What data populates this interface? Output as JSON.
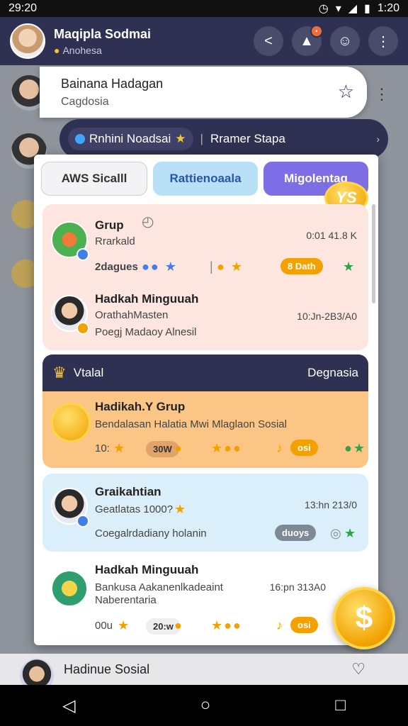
{
  "status": {
    "time": "29:20",
    "right_time": "1:20"
  },
  "appbar": {
    "title": "Maqipla Sodmai",
    "subtitle": "Anohesa"
  },
  "contact": {
    "name": "Bainana Hadagan",
    "sub": "Cagdosia"
  },
  "pill": {
    "left": "Rnhini Noadsai",
    "right": "Rramer Stapa"
  },
  "tabs": [
    "AWS Sicalll",
    "Rattienoaala",
    "Migolentag"
  ],
  "badge": {
    "ys": "YS"
  },
  "group1": {
    "title": "Grup",
    "subtitle": "Rrarkald",
    "meta": "0:01 41.8 K",
    "tagline": "2dagues",
    "tag_pill": "8 Dath"
  },
  "person1": {
    "title": "Hadkah Minguuah",
    "line1": "OrathahMasten",
    "line2": "Poegj Madaoy Alnesil",
    "meta": "10:Jn-2B3/A0"
  },
  "section": {
    "left": "Vtalal",
    "right": "Degnasia"
  },
  "item_orange": {
    "title": "Hadikah.Y Grup",
    "line": "Bendalasan Halatia Mwi Mlaglaon Sosial",
    "count": "10:",
    "tag": "30W",
    "pill": "osi"
  },
  "item_blue": {
    "title": "Graikahtian",
    "line": "Geatlatas 1000?",
    "link": "Coegalrdadiany holanin",
    "meta": "13:hn 213/0",
    "pill": "duoys"
  },
  "item_white": {
    "title": "Hadkah Minguuah",
    "line1": "Bankusa Aakanenlkadeaint",
    "line2": "Naberentaria",
    "meta": "16:pn 313A0",
    "count": "00u",
    "tag": "20:w",
    "pill": "osi"
  },
  "bottom": {
    "name": "Hadinue Sosial"
  }
}
